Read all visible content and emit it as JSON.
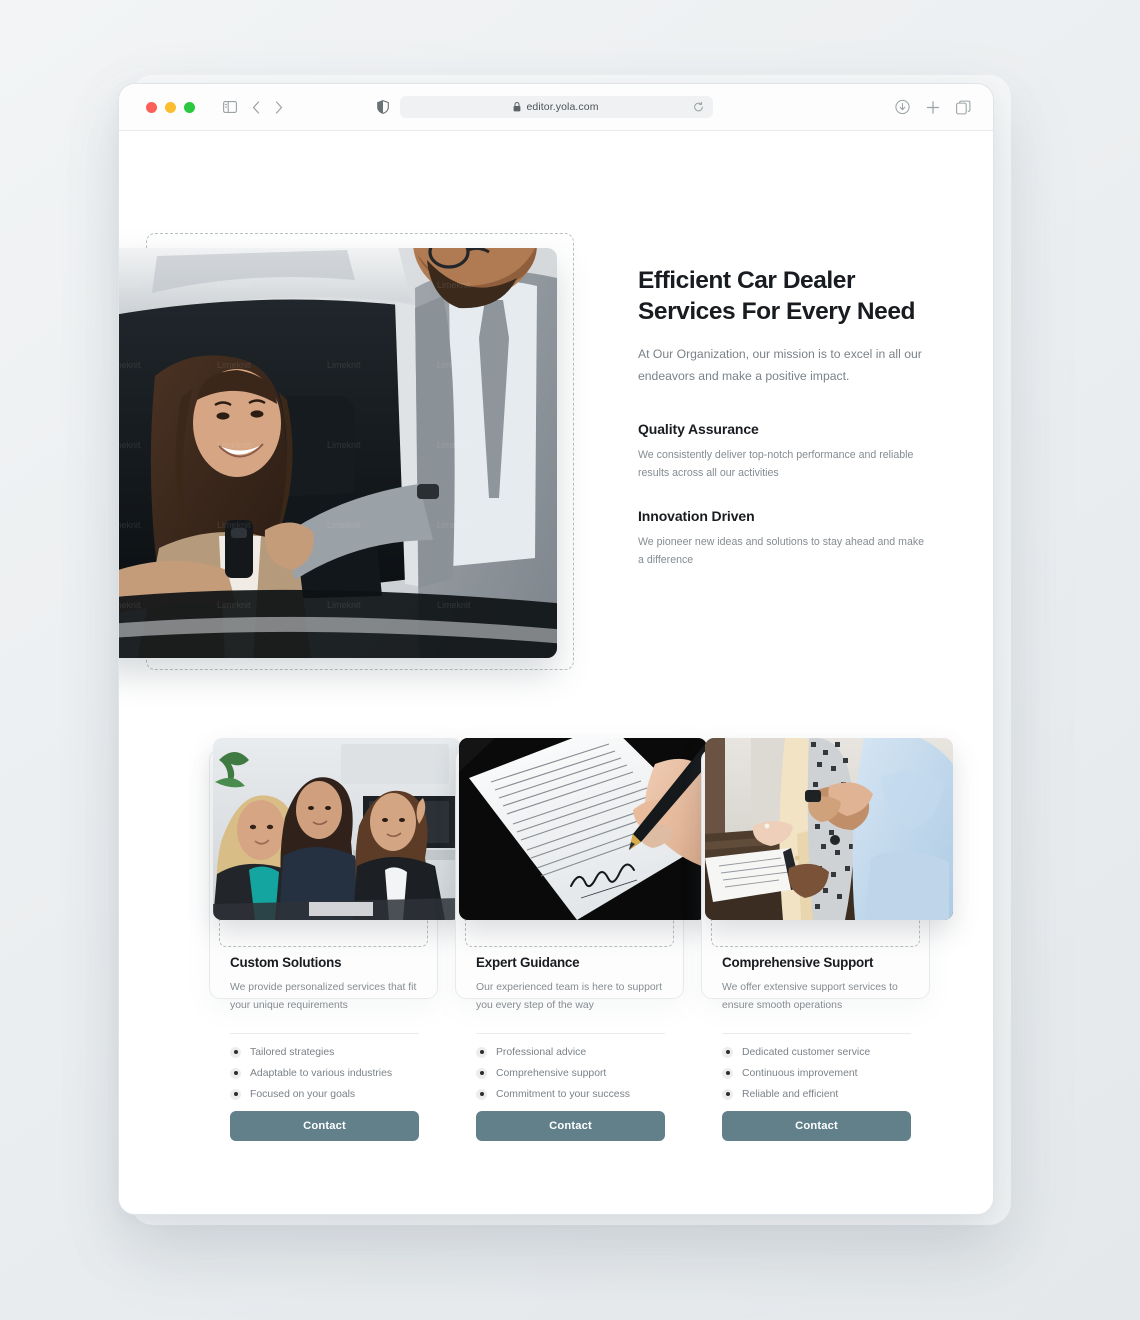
{
  "browser": {
    "traffic_lights": [
      "close",
      "minimize",
      "maximize"
    ],
    "sidebar_icon": "sidebar-icon",
    "back_icon": "chevron-left-icon",
    "forward_icon": "chevron-right-icon",
    "shield_icon": "shield-icon",
    "lock_icon": "lock-icon",
    "url": "editor.yola.com",
    "reload_icon": "reload-icon",
    "download_icon": "download-icon",
    "new_tab_icon": "plus-icon",
    "tab_overview_icon": "tab-overview-icon"
  },
  "hero": {
    "image_alt": "car-dealer-handing-keys",
    "title": "Efficient Car Dealer Services For Every Need",
    "subtitle": "At Our Organization, our mission is to excel in all our endeavors and make a positive impact.",
    "features": [
      {
        "heading": "Quality Assurance",
        "text": "We consistently deliver top-notch performance and reliable results across all our activities"
      },
      {
        "heading": "Innovation Driven",
        "text": "We pioneer new ideas and solutions to stay ahead and make a difference"
      }
    ]
  },
  "cards": [
    {
      "image_alt": "business-team-meeting",
      "title": "Custom Solutions",
      "text": "We provide personalized services that fit your unique requirements",
      "bullets": [
        "Tailored strategies",
        "Adaptable to various industries",
        "Focused on your goals"
      ],
      "button_label": "Contact"
    },
    {
      "image_alt": "signing-contract-with-pen",
      "title": "Expert Guidance",
      "text": "Our experienced team is here to support you every step of the way",
      "bullets": [
        "Professional advice",
        "Comprehensive support",
        "Commitment to your success"
      ],
      "button_label": "Contact"
    },
    {
      "image_alt": "handshake-over-documents",
      "title": "Comprehensive Support",
      "text": "We offer extensive support services to ensure smooth operations",
      "bullets": [
        "Dedicated customer service",
        "Continuous improvement",
        "Reliable and efficient"
      ],
      "button_label": "Contact"
    }
  ],
  "colors": {
    "button": "#61808a",
    "heading": "#181c20",
    "body_text": "#858c91",
    "dashed_outline": "#b9c0c4"
  }
}
